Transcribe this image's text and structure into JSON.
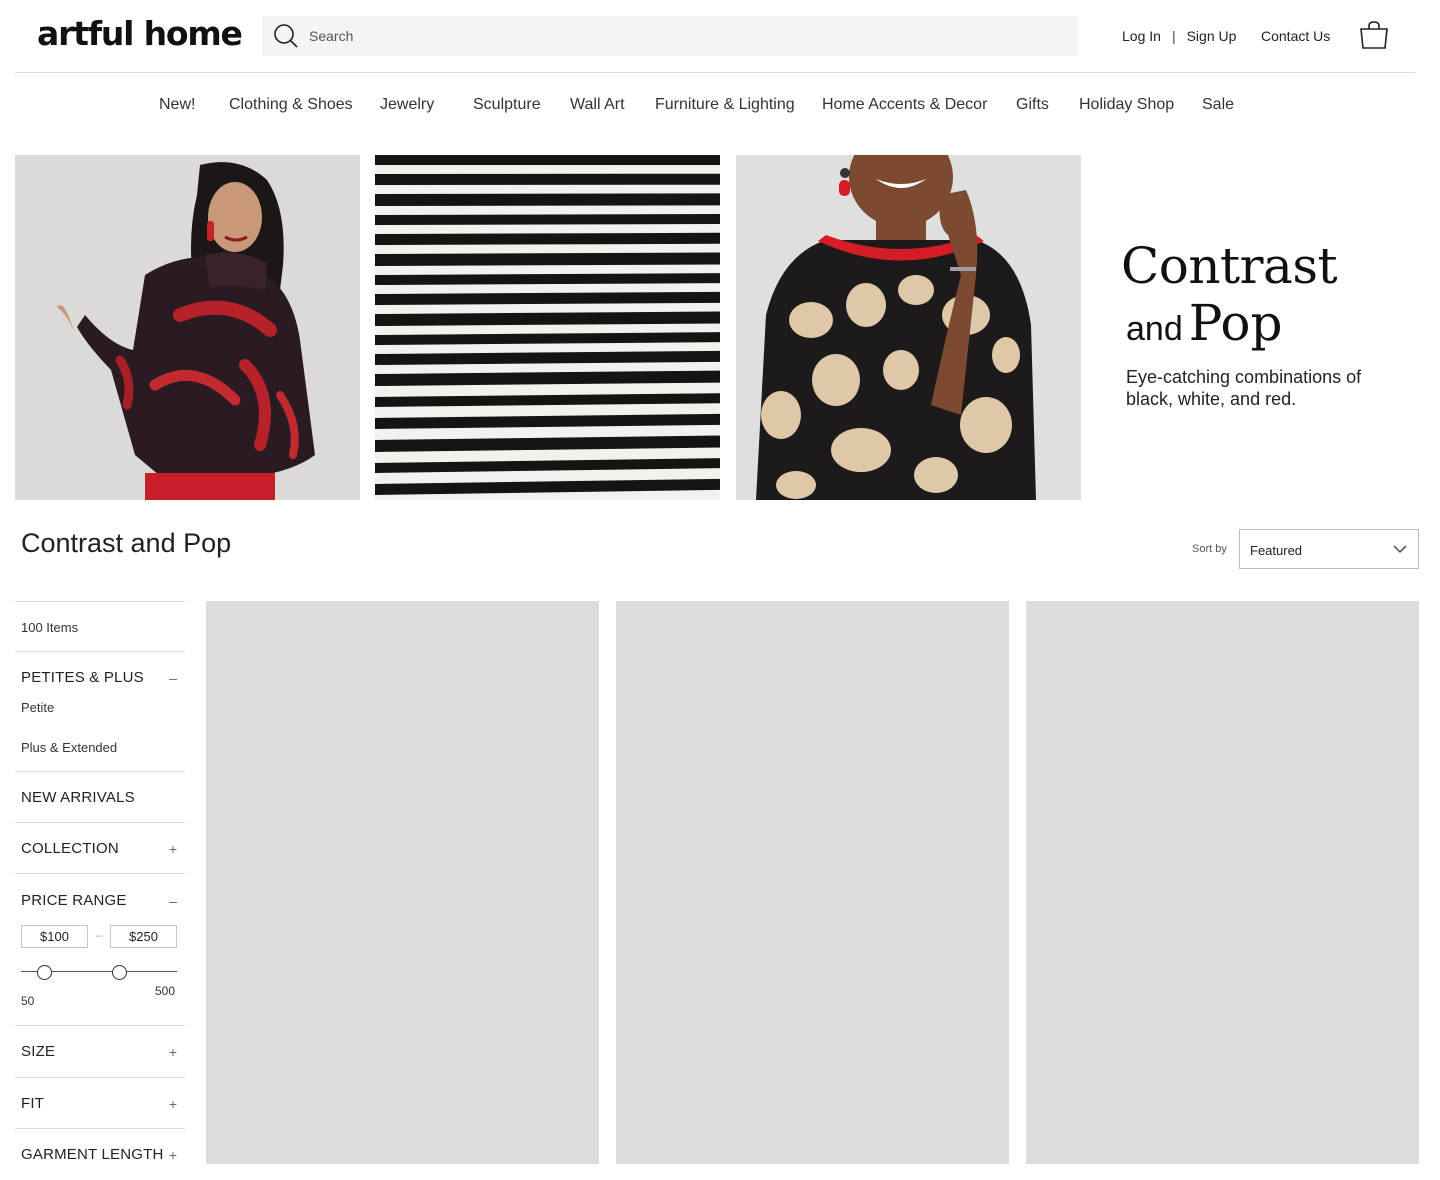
{
  "header": {
    "logo": "artful home",
    "search_placeholder": "Search",
    "login": "Log In",
    "separator": "|",
    "signup": "Sign Up",
    "contact": "Contact Us"
  },
  "nav": {
    "items": [
      "New!",
      "Clothing & Shoes",
      "Jewelry",
      "Sculpture",
      "Wall Art",
      "Furniture & Lighting",
      "Home Accents & Decor",
      "Gifts",
      "Holiday Shop",
      "Sale"
    ]
  },
  "hero": {
    "title_line1": "Contrast",
    "title_and": "and",
    "title_pop": "Pop",
    "subtitle": "Eye-catching combinations of black, white, and red."
  },
  "page": {
    "title": "Contrast and Pop",
    "sort_label": "Sort by",
    "sort_value": "Featured"
  },
  "sidebar": {
    "item_count": "100 Items",
    "petites_plus": {
      "title": "PETITES & PLUS",
      "toggle": "–",
      "options": [
        "Petite",
        "Plus & Extended"
      ]
    },
    "new_arrivals": "NEW ARRIVALS",
    "collection": {
      "title": "COLLECTION",
      "toggle": "+"
    },
    "price_range": {
      "title": "PRICE RANGE",
      "toggle": "–",
      "min_value": "$100",
      "max_value": "$250",
      "dash": "–",
      "slider_min": "50",
      "slider_max": "500"
    },
    "size": {
      "title": "SIZE",
      "toggle": "+"
    },
    "fit": {
      "title": "FIT",
      "toggle": "+"
    },
    "garment_length": {
      "title": "GARMENT LENGTH",
      "toggle": "+"
    }
  },
  "colors": {
    "placeholder_gray": "#dcdcdc",
    "search_bg": "#f4f4f4",
    "accent_red": "#d0201f"
  }
}
